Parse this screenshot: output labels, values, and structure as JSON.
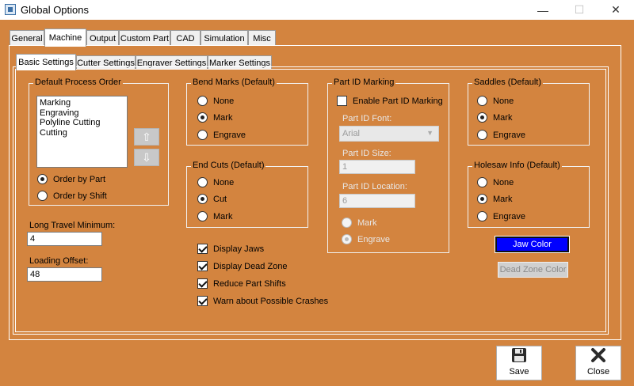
{
  "window": {
    "title": "Global Options",
    "minimize_glyph": "—",
    "maximize_glyph": "☐",
    "close_glyph": "✕"
  },
  "tabs": [
    "General",
    "Machine",
    "Output",
    "Custom Part",
    "CAD",
    "Simulation",
    "Misc"
  ],
  "active_tab": "Machine",
  "subtabs": [
    "Basic Settings",
    "Cutter Settings",
    "Engraver Settings",
    "Marker Settings"
  ],
  "active_subtab": "Basic Settings",
  "process_order": {
    "label": "Default Process Order",
    "items": [
      "Marking",
      "Engraving",
      "Polyline Cutting",
      "Cutting"
    ],
    "up_glyph": "⇧",
    "down_glyph": "⇩",
    "options": [
      {
        "label": "Order by Part",
        "checked": true
      },
      {
        "label": "Order by Shift",
        "checked": false
      }
    ]
  },
  "long_travel": {
    "label": "Long Travel Minimum:",
    "value": "4"
  },
  "loading_offset": {
    "label": "Loading Offset:",
    "value": "48"
  },
  "bend_marks": {
    "label": "Bend Marks (Default)",
    "options": [
      {
        "label": "None",
        "checked": false
      },
      {
        "label": "Mark",
        "checked": true
      },
      {
        "label": "Engrave",
        "checked": false
      }
    ]
  },
  "end_cuts": {
    "label": "End Cuts (Default)",
    "options": [
      {
        "label": "None",
        "checked": false
      },
      {
        "label": "Cut",
        "checked": true
      },
      {
        "label": "Mark",
        "checked": false
      }
    ]
  },
  "display_checks": [
    {
      "label": "Display Jaws",
      "checked": true
    },
    {
      "label": "Display Dead Zone",
      "checked": true
    },
    {
      "label": "Reduce Part Shifts",
      "checked": true
    },
    {
      "label": "Warn about Possible Crashes",
      "checked": true
    }
  ],
  "part_id": {
    "label": "Part ID Marking",
    "enable_label": "Enable Part ID Marking",
    "enabled": false,
    "font_label": "Part ID Font:",
    "font_value": "Arial",
    "size_label": "Part ID Size:",
    "size_value": "1",
    "location_label": "Part ID Location:",
    "location_value": "6",
    "options": [
      {
        "label": "Mark",
        "checked": false
      },
      {
        "label": "Engrave",
        "checked": true
      }
    ]
  },
  "saddles": {
    "label": "Saddles (Default)",
    "options": [
      {
        "label": "None",
        "checked": false
      },
      {
        "label": "Mark",
        "checked": true
      },
      {
        "label": "Engrave",
        "checked": false
      }
    ]
  },
  "holesaw": {
    "label": "Holesaw Info (Default)",
    "options": [
      {
        "label": "None",
        "checked": false
      },
      {
        "label": "Mark",
        "checked": true
      },
      {
        "label": "Engrave",
        "checked": false
      }
    ]
  },
  "jaw_color": {
    "label": "Jaw Color",
    "color": "#0000FF"
  },
  "dead_zone_color": {
    "label": "Dead Zone Color"
  },
  "buttons": {
    "save": "Save",
    "close": "Close"
  },
  "colors": {
    "background": "#D3843F",
    "accent": "#0000FF"
  }
}
